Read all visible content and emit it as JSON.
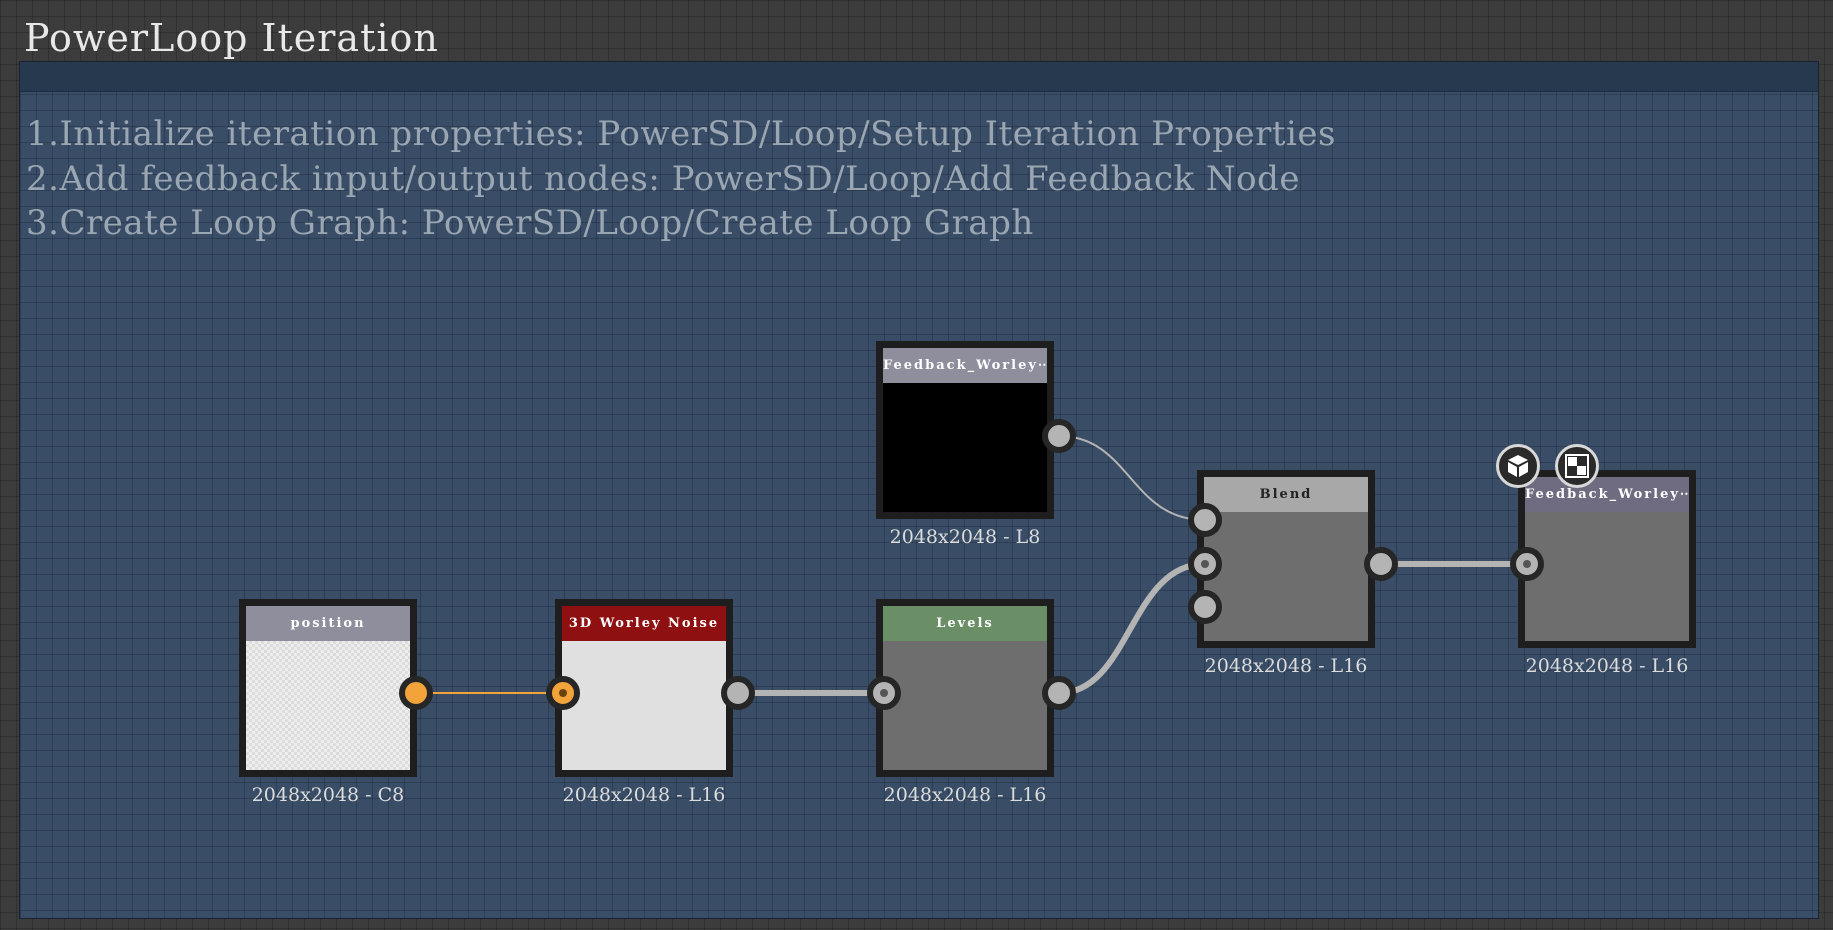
{
  "frame": {
    "title": "PowerLoop Iteration",
    "instructions": [
      "1.Initialize iteration properties: PowerSD/Loop/Setup Iteration Properties",
      "2.Add feedback input/output nodes: PowerSD/Loop/Add Feedback Node",
      "3.Create Loop Graph: PowerSD/Loop/Create Loop Graph"
    ]
  },
  "nodes": {
    "position": {
      "title": "position",
      "label": "2048x2048 - C8"
    },
    "worley": {
      "title": "3D Worley Noise",
      "label": "2048x2048 - L16"
    },
    "levels": {
      "title": "Levels",
      "label": "2048x2048 - L16"
    },
    "feedback_in": {
      "title": "Feedback_Worley⋯",
      "label": "2048x2048 - L8"
    },
    "blend": {
      "title": "Blend",
      "label": "2048x2048 - L16"
    },
    "feedback_out": {
      "title": "Feedback_Worley⋯",
      "label": "2048x2048 - L16"
    }
  },
  "icons": {
    "output_badge_1": "3d-cube-icon",
    "output_badge_2": "checker-icon"
  },
  "colors": {
    "frame_bg": "#394d67",
    "position_header": "#8f8e9c",
    "worley_header": "#8e1010",
    "levels_header": "#6a8f66",
    "feedback_in_header": "#8f8e9c",
    "blend_header": "#a8a8a8",
    "feedback_out_header": "#6f6c82",
    "port_orange": "#f2a33a",
    "wire_gray": "#b4b4b4"
  }
}
